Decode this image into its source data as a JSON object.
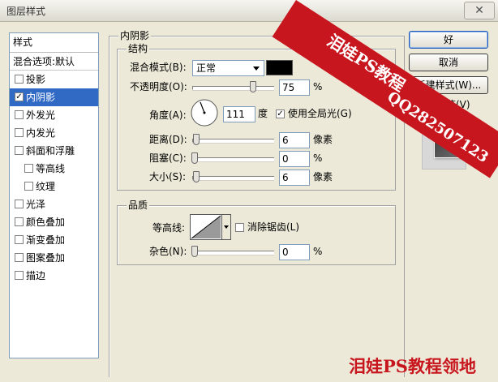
{
  "window": {
    "title": "图层样式",
    "close_glyph": "✕"
  },
  "list": {
    "header": "样式",
    "blend_item": "混合选项:默认",
    "items": [
      {
        "label": "投影",
        "checked": false,
        "indent": false,
        "selected": false
      },
      {
        "label": "内阴影",
        "checked": true,
        "indent": false,
        "selected": true
      },
      {
        "label": "外发光",
        "checked": false,
        "indent": false,
        "selected": false
      },
      {
        "label": "内发光",
        "checked": false,
        "indent": false,
        "selected": false
      },
      {
        "label": "斜面和浮雕",
        "checked": false,
        "indent": false,
        "selected": false
      },
      {
        "label": "等高线",
        "checked": false,
        "indent": true,
        "selected": false
      },
      {
        "label": "纹理",
        "checked": false,
        "indent": true,
        "selected": false
      },
      {
        "label": "光泽",
        "checked": false,
        "indent": false,
        "selected": false
      },
      {
        "label": "颜色叠加",
        "checked": false,
        "indent": false,
        "selected": false
      },
      {
        "label": "渐变叠加",
        "checked": false,
        "indent": false,
        "selected": false
      },
      {
        "label": "图案叠加",
        "checked": false,
        "indent": false,
        "selected": false
      },
      {
        "label": "描边",
        "checked": false,
        "indent": false,
        "selected": false
      }
    ]
  },
  "inner_shadow": {
    "title": "内阴影",
    "structure": {
      "title": "结构",
      "blend_mode_label": "混合模式(B):",
      "blend_mode_value": "正常",
      "shadow_color": "#000000",
      "opacity_label": "不透明度(O):",
      "opacity_value": "75",
      "opacity_unit": "%",
      "opacity_fraction": 0.75,
      "angle_label": "角度(A):",
      "angle_value": "111",
      "angle_unit": "度",
      "global_light_label": "使用全局光(G)",
      "global_light_checked": true,
      "distance_label": "距离(D):",
      "distance_value": "6",
      "distance_unit": "像素",
      "choke_label": "阻塞(C):",
      "choke_value": "0",
      "choke_unit": "%",
      "size_label": "大小(S):",
      "size_value": "6",
      "size_unit": "像素"
    },
    "quality": {
      "title": "品质",
      "contour_label": "等高线:",
      "antialias_label": "消除锯齿(L)",
      "antialias_checked": false,
      "noise_label": "杂色(N):",
      "noise_value": "0",
      "noise_unit": "%"
    }
  },
  "buttons": {
    "ok": "好",
    "cancel": "取消",
    "new_style": "新建样式(W)...",
    "preview_label": "预览(V)",
    "preview_checked": true
  },
  "watermark": {
    "band_title": "泪娃PS教程",
    "band_qq": "QQ282507123",
    "band_color": "#c8161e",
    "bottom": "泪娃PS教程领地"
  }
}
